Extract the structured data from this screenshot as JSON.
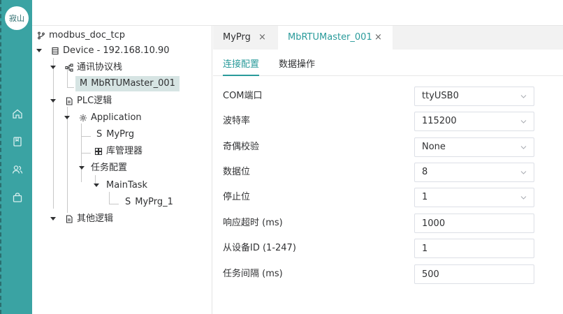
{
  "brand": {
    "logo_text": "寂山"
  },
  "rail": {
    "icons": [
      "home-icon",
      "book-icon",
      "users-icon",
      "bag-icon"
    ]
  },
  "tree": {
    "root": {
      "label": "modbus_doc_tcp",
      "icon": "branch-icon"
    },
    "device": {
      "label": "Device - 192.168.10.90",
      "icon": "device-icon"
    },
    "comm_stack": {
      "label": "通讯协议栈",
      "icon": "network-icon"
    },
    "master": {
      "prefix": "M",
      "label": "MbRTUMaster_001"
    },
    "plc_logic": {
      "label": "PLC逻辑",
      "icon": "document-icon"
    },
    "application": {
      "label": "Application",
      "icon": "gear-icon"
    },
    "myprg": {
      "prefix": "S",
      "label": "MyPrg"
    },
    "library": {
      "label": "库管理器",
      "icon": "grid-icon"
    },
    "task_config": {
      "label": "任务配置"
    },
    "main_task": {
      "label": "MainTask"
    },
    "myprg_1": {
      "prefix": "S",
      "label": "MyPrg_1"
    },
    "other_logic": {
      "label": "其他逻辑",
      "icon": "document-icon"
    }
  },
  "tabs": [
    {
      "label": "MyPrg",
      "close": "×",
      "active": false
    },
    {
      "label": "MbRTUMaster_001",
      "close": "×",
      "active": true
    }
  ],
  "subtabs": [
    {
      "label": "连接配置",
      "active": true
    },
    {
      "label": "数据操作",
      "active": false
    }
  ],
  "form": {
    "com_port": {
      "label": "COM端口",
      "value": "ttyUSB0"
    },
    "baud_rate": {
      "label": "波特率",
      "value": "115200"
    },
    "parity": {
      "label": "奇偶校验",
      "value": "None"
    },
    "data_bits": {
      "label": "数据位",
      "value": "8"
    },
    "stop_bits": {
      "label": "停止位",
      "value": "1"
    },
    "timeout": {
      "label": "响应超时 (ms)",
      "value": "1000"
    },
    "slave_id": {
      "label": "从设备ID (1-247)",
      "value": "1"
    },
    "interval": {
      "label": "任务间隔 (ms)",
      "value": "500"
    }
  },
  "colors": {
    "accent": "#2a9b9b",
    "rail": "#3aa3a3",
    "selected_row": "#d6e4e3"
  }
}
